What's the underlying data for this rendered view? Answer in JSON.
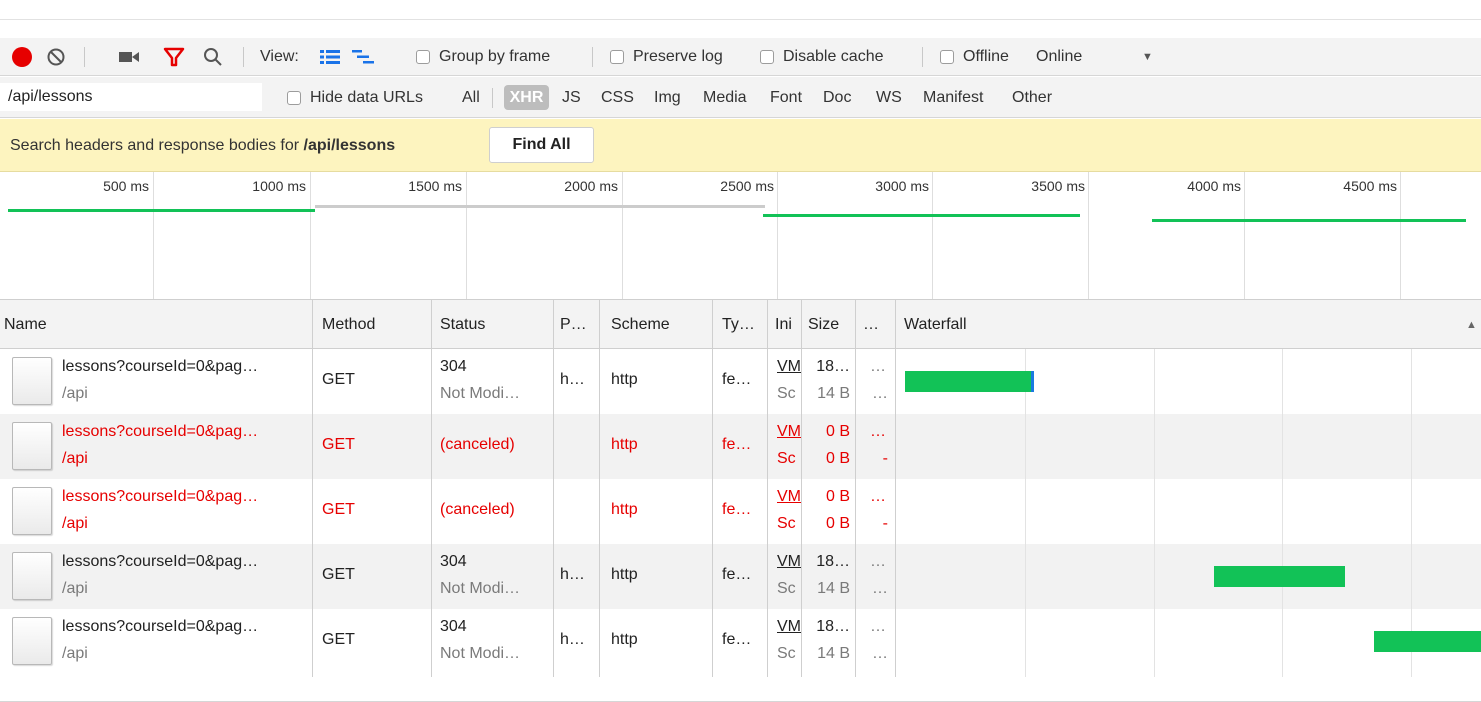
{
  "toolbar": {
    "view_label": "View:",
    "group_by_frame": "Group by frame",
    "preserve_log": "Preserve log",
    "disable_cache": "Disable cache",
    "offline": "Offline",
    "throttling": "Online",
    "record_color": "#e60000",
    "filter_icon_color": "#e60000",
    "view_icon_color": "#1a73e8"
  },
  "filter": {
    "value": "/api/lessons",
    "hide_data_urls": "Hide data URLs",
    "types": [
      "All",
      "XHR",
      "JS",
      "CSS",
      "Img",
      "Media",
      "Font",
      "Doc",
      "WS",
      "Manifest",
      "Other"
    ],
    "selected": "XHR"
  },
  "search_banner": {
    "prefix": "Search headers and response bodies for ",
    "query": "/api/lessons",
    "find_all": "Find All",
    "background": "#fdf4bf"
  },
  "overview": {
    "ticks": [
      "500 ms",
      "1000 ms",
      "1500 ms",
      "2000 ms",
      "2500 ms",
      "3000 ms",
      "3500 ms",
      "4000 ms",
      "4500 ms"
    ]
  },
  "table": {
    "columns": [
      "Name",
      "Method",
      "Status",
      "P…",
      "Scheme",
      "Ty…",
      "Ini",
      "Size",
      "…",
      "Waterfall"
    ],
    "rows": [
      {
        "name": "lessons?courseId=0&pag…",
        "path": "/api",
        "method": "GET",
        "status": "304",
        "status_text": "Not Modi…",
        "protocol": "h…",
        "scheme": "http",
        "type": "fe…",
        "initiator": "VM",
        "initiator2": "Sc",
        "size": "18…",
        "size2": "14 B",
        "time": "…",
        "time2": "…",
        "error": false
      },
      {
        "name": "lessons?courseId=0&pag…",
        "path": "/api",
        "method": "GET",
        "status": "(canceled)",
        "status_text": "",
        "protocol": "",
        "scheme": "http",
        "type": "fe…",
        "initiator": "VM",
        "initiator2": "Sc",
        "size": "0 B",
        "size2": "0 B",
        "time": "…",
        "time2": "-",
        "error": true
      },
      {
        "name": "lessons?courseId=0&pag…",
        "path": "/api",
        "method": "GET",
        "status": "(canceled)",
        "status_text": "",
        "protocol": "",
        "scheme": "http",
        "type": "fe…",
        "initiator": "VM",
        "initiator2": "Sc",
        "size": "0 B",
        "size2": "0 B",
        "time": "…",
        "time2": "-",
        "error": true
      },
      {
        "name": "lessons?courseId=0&pag…",
        "path": "/api",
        "method": "GET",
        "status": "304",
        "status_text": "Not Modi…",
        "protocol": "h…",
        "scheme": "http",
        "type": "fe…",
        "initiator": "VM",
        "initiator2": "Sc",
        "size": "18…",
        "size2": "14 B",
        "time": "…",
        "time2": "…",
        "error": false
      },
      {
        "name": "lessons?courseId=0&pag…",
        "path": "/api",
        "method": "GET",
        "status": "304",
        "status_text": "Not Modi…",
        "protocol": "h…",
        "scheme": "http",
        "type": "fe…",
        "initiator": "VM",
        "initiator2": "Sc",
        "size": "18…",
        "size2": "14 B",
        "time": "…",
        "time2": "…",
        "error": false
      }
    ],
    "error_color": "#e60000",
    "waterfall_color": "#12c257"
  }
}
